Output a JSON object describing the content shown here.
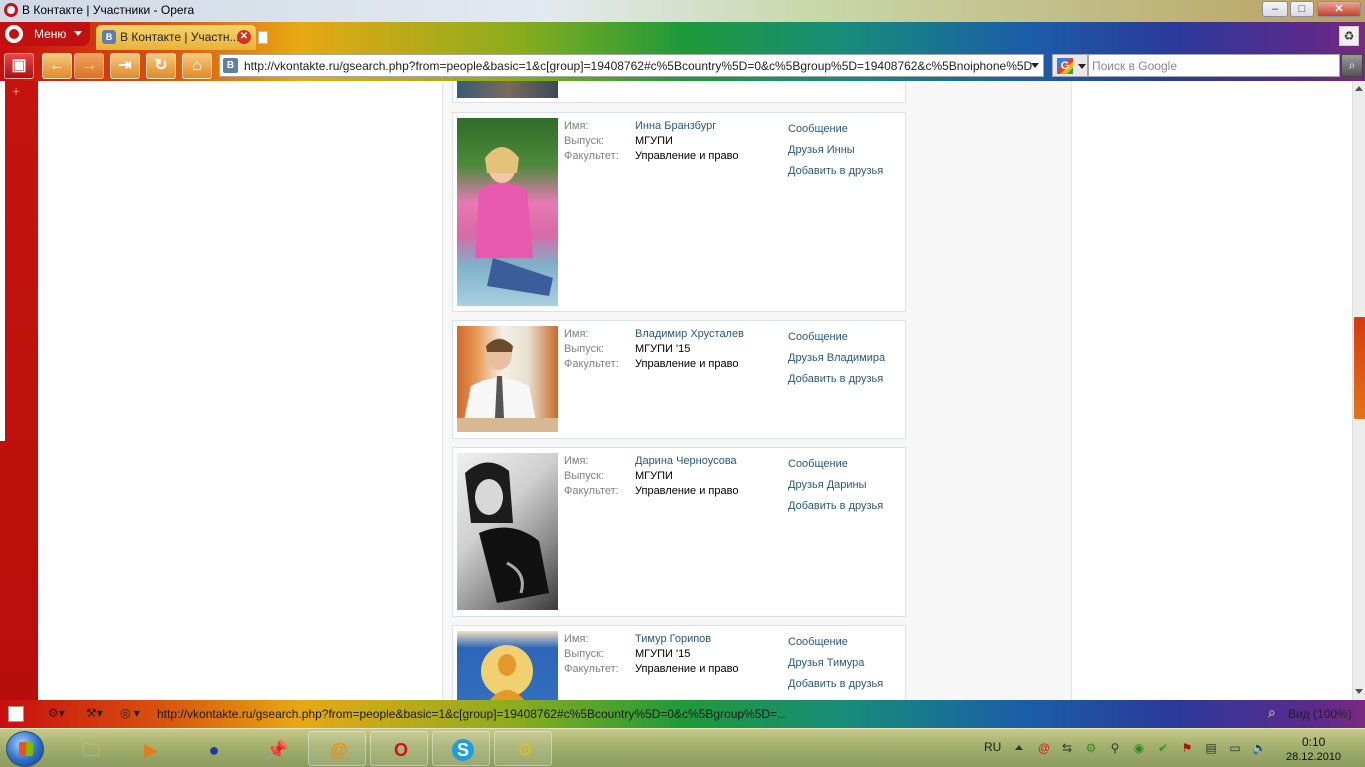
{
  "window": {
    "title": "В Контакте | Участники - Opera",
    "controls": {
      "minimize": "–",
      "maximize": "□",
      "close": "✕"
    }
  },
  "tabbar": {
    "menu_label": "Меню",
    "tab_title": "В Контакте | Участн...",
    "tab_favicon": "В"
  },
  "toolbar": {
    "url": "http://vkontakte.ru/gsearch.php?from=people&basic=1&c[group]=19408762#c%5Bcountry%5D=0&c%5Bgroup%5D=19408762&c%5Bnoiphone%5D",
    "url_favicon": "В",
    "search_placeholder": "Поиск в Google",
    "search_engine": "G"
  },
  "results": {
    "field_labels": {
      "name": "Имя:",
      "year": "Выпуск:",
      "faculty": "Факультет:"
    },
    "items": [
      {
        "name": "Инна Бранзбург",
        "year": "МГУПИ",
        "faculty": "Управление и право",
        "actions": [
          "Сообщение",
          "Друзья Инны",
          "Добавить в друзья"
        ],
        "photo_colors": [
          "#2f6d2a",
          "#e67ab4",
          "#7fb0c8"
        ]
      },
      {
        "name": "Владимир Хрусталев",
        "year": "МГУПИ '15",
        "faculty": "Управление и право",
        "actions": [
          "Сообщение",
          "Друзья Владимира",
          "Добавить в друзья"
        ],
        "photo_colors": [
          "#d06a2a",
          "#f1f1f1",
          "#7a4a2a"
        ]
      },
      {
        "name": "Дарина Черноусова",
        "year": "МГУПИ",
        "faculty": "Управление и право",
        "actions": [
          "Сообщение",
          "Друзья Дарины",
          "Добавить в друзья"
        ],
        "photo_colors": [
          "#1a1a1a",
          "#cfcfcf",
          "#6a6a6a"
        ]
      },
      {
        "name": "Тимур Горипов",
        "year": "МГУПИ '15",
        "faculty": "Управление и право",
        "actions": [
          "Сообщение",
          "Друзья Тимура",
          "Добавить в друзья"
        ],
        "photo_colors": [
          "#2d66b8",
          "#e39a2a",
          "#f0d070"
        ]
      }
    ]
  },
  "statusbar": {
    "url": "http://vkontakte.ru/gsearch.php?from=people&basic=1&c[group]=19408762#c%5Bcountry%5D=0&c%5Bgroup%5D=...",
    "zoom": "Вид (100%)"
  },
  "taskbar": {
    "apps": [
      {
        "name": "explorer",
        "glyph": "🗀"
      },
      {
        "name": "media-player",
        "glyph": "▶"
      },
      {
        "name": "agent",
        "glyph": "●"
      },
      {
        "name": "pin",
        "glyph": "📌"
      },
      {
        "name": "mail-agent",
        "glyph": "@"
      },
      {
        "name": "opera",
        "glyph": "O"
      },
      {
        "name": "skype",
        "glyph": "S"
      },
      {
        "name": "app",
        "glyph": "⚙"
      }
    ],
    "lang": "RU",
    "time": "0:10",
    "date": "28.12.2010"
  },
  "colors": {
    "link": "#2b587a",
    "label": "#808080",
    "opera_red": "#c11010"
  }
}
